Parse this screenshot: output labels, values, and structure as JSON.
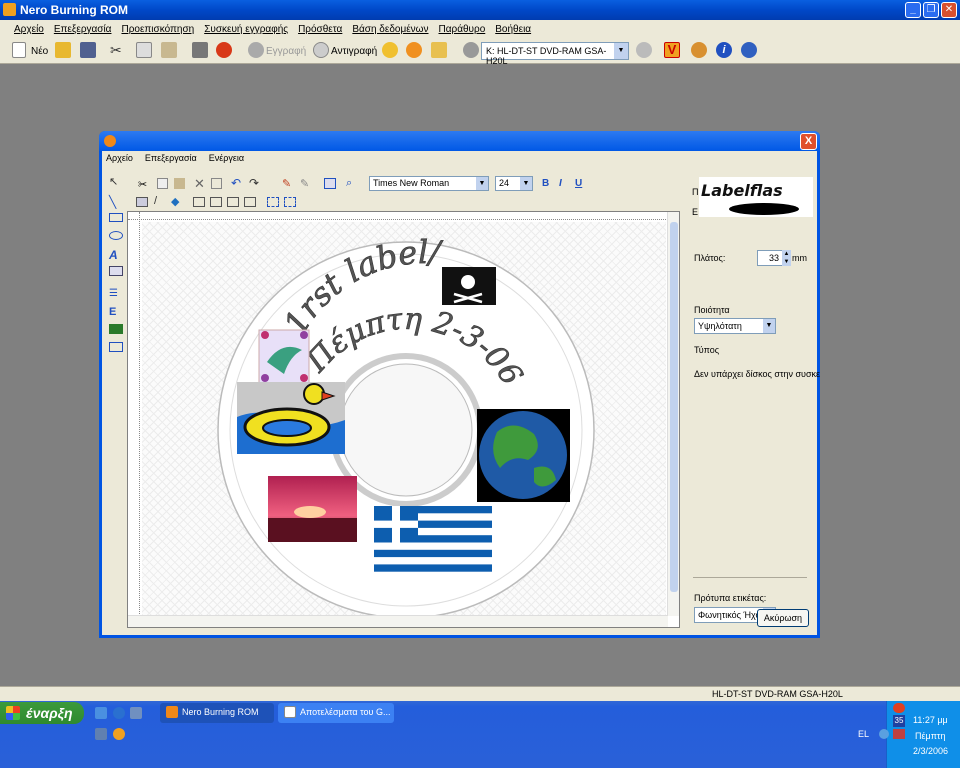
{
  "app": {
    "title": "Nero Burning ROM",
    "menu": [
      "Αρχείο",
      "Επεξεργασία",
      "Προεπισκόπηση",
      "Συσκευή εγγραφής",
      "Πρόσθετα",
      "Βάση δεδομένων",
      "Παράθυρο",
      "Βοήθεια"
    ]
  },
  "toolbar": {
    "new_label": "Νέο",
    "burn_label": "Εγγραφή",
    "copy_label": "Αντιγραφή",
    "drive_select": "K: HL-DT-ST DVD-RAM GSA-H20L"
  },
  "dialog": {
    "menu": [
      "Αρχείο",
      "Επεξεργασία",
      "Ενέργεια"
    ],
    "font": "Times New Roman",
    "font_size": "24",
    "bold_label": "B",
    "italic_label": "I",
    "underline_label": "U",
    "close_symbol": "X"
  },
  "canvas": {
    "text_line1": "1rst label/",
    "text_line2": "Πέμπτη 2-3-06"
  },
  "right_panel": {
    "cut_label_1": "Π",
    "cut_label_2": "Ε",
    "logo_text": "Labelflas",
    "width_label": "Πλάτος:",
    "width_value": "33",
    "width_unit": "mm",
    "quality_label": "Ποιότητα",
    "quality_value": "Υψηλότατη",
    "type_label": "Τύπος",
    "type_value": "Δεν υπάρχει δίσκος στην συσκε",
    "template_label": "Πρότυπα ετικέτας:",
    "template_value": "Φωνητικός Ήχος",
    "cancel_label": "Ακύρωση"
  },
  "status": {
    "drive": "HL-DT-ST DVD-RAM GSA-H20L"
  },
  "taskbar": {
    "start_label": "έναρξη",
    "tasks": [
      "Nero Burning ROM",
      "Αποτελέσματα του G..."
    ],
    "lang": "EL",
    "time": "11:27 μμ",
    "day": "Πέμπτη",
    "date": "2/3/2006",
    "calendar_day": "35"
  },
  "colors": {
    "titlebar": "#0048c8",
    "dialog_border": "#0054e3",
    "start_green": "#2f8a2f",
    "flag_blue": "#0d5eaf"
  }
}
